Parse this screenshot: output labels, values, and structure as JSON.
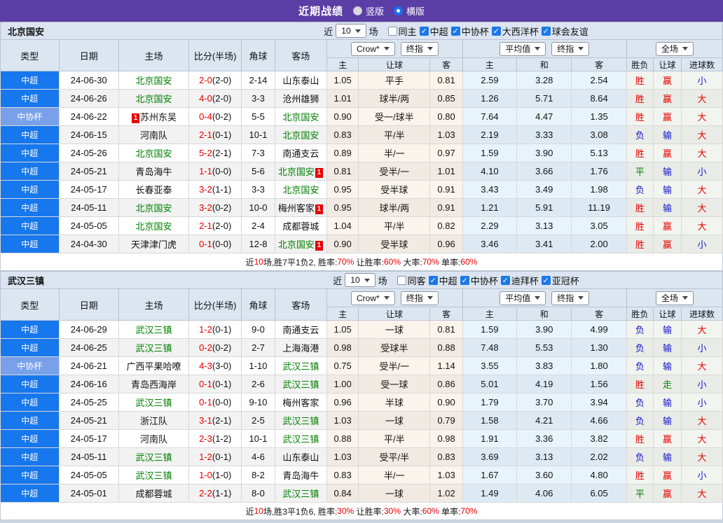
{
  "title_bar": {
    "title": "近期战绩",
    "vertical_label": "竖版",
    "horizontal_label": "横版"
  },
  "table_header": {
    "type": "类型",
    "date": "日期",
    "home": "主场",
    "score": "比分(半场)",
    "corner": "角球",
    "away": "客场",
    "sub": {
      "home_odds": "主",
      "handicap": "让球",
      "away_odds": "客",
      "avg_home": "主",
      "avg_draw": "和",
      "avg_away": "客",
      "result": "胜负",
      "handicap_result": "让球",
      "goals": "进球数"
    },
    "selects": {
      "company": "Crow*",
      "company_stage": "终指",
      "average": "平均值",
      "average_stage": "终指",
      "fulltime": "全场"
    }
  },
  "colors": {
    "accent_purple": "#5b3da6",
    "league_super": "#1777ec",
    "league_cup": "#79a1ea",
    "win_red": "#e60000",
    "lose_blue": "#1414cd",
    "draw_green": "#008000",
    "team_green": "#008000"
  },
  "sections": [
    {
      "team": "北京国安",
      "filters": {
        "near": "近",
        "count": "10",
        "unit": "场",
        "same": {
          "label": "同主",
          "checked": false
        },
        "leagues": [
          {
            "label": "中超",
            "checked": true
          },
          {
            "label": "中协杯",
            "checked": true
          },
          {
            "label": "大西洋杯",
            "checked": true
          },
          {
            "label": "球会友谊",
            "checked": true
          }
        ]
      },
      "rows": [
        {
          "league": "中超",
          "cup": false,
          "date": "24-06-30",
          "home": {
            "name": "北京国安",
            "green": true
          },
          "score": "2-0",
          "half": "(2-0)",
          "corner": "2-14",
          "away": {
            "name": "山东泰山"
          },
          "odds": [
            "1.05",
            "平手",
            "0.81"
          ],
          "avg": [
            "2.59",
            "3.28",
            "2.54"
          ],
          "res": [
            {
              "t": "胜",
              "c": "r"
            },
            {
              "t": "赢",
              "c": "r"
            },
            {
              "t": "小",
              "c": "b"
            }
          ]
        },
        {
          "league": "中超",
          "cup": false,
          "date": "24-06-26",
          "home": {
            "name": "北京国安",
            "green": true
          },
          "score": "4-0",
          "half": "(2-0)",
          "corner": "3-3",
          "away": {
            "name": "沧州雄狮"
          },
          "odds": [
            "1.01",
            "球半/两",
            "0.85"
          ],
          "avg": [
            "1.26",
            "5.71",
            "8.64"
          ],
          "res": [
            {
              "t": "胜",
              "c": "r"
            },
            {
              "t": "赢",
              "c": "r"
            },
            {
              "t": "大",
              "c": "r"
            }
          ]
        },
        {
          "league": "中协杯",
          "cup": true,
          "date": "24-06-22",
          "home": {
            "name": "苏州东吴",
            "card": "before"
          },
          "score": "0-4",
          "half": "(0-2)",
          "corner": "5-5",
          "away": {
            "name": "北京国安",
            "green": true
          },
          "odds": [
            "0.90",
            "受一/球半",
            "0.80"
          ],
          "avg": [
            "7.64",
            "4.47",
            "1.35"
          ],
          "res": [
            {
              "t": "胜",
              "c": "r"
            },
            {
              "t": "赢",
              "c": "r"
            },
            {
              "t": "大",
              "c": "r"
            }
          ]
        },
        {
          "league": "中超",
          "cup": false,
          "date": "24-06-15",
          "home": {
            "name": "河南队"
          },
          "score": "2-1",
          "half": "(0-1)",
          "corner": "10-1",
          "away": {
            "name": "北京国安",
            "green": true
          },
          "odds": [
            "0.83",
            "平/半",
            "1.03"
          ],
          "avg": [
            "2.19",
            "3.33",
            "3.08"
          ],
          "res": [
            {
              "t": "负",
              "c": "b"
            },
            {
              "t": "输",
              "c": "b"
            },
            {
              "t": "大",
              "c": "r"
            }
          ]
        },
        {
          "league": "中超",
          "cup": false,
          "date": "24-05-26",
          "home": {
            "name": "北京国安",
            "green": true
          },
          "score": "5-2",
          "half": "(2-1)",
          "corner": "7-3",
          "away": {
            "name": "南通支云"
          },
          "odds": [
            "0.89",
            "半/一",
            "0.97"
          ],
          "avg": [
            "1.59",
            "3.90",
            "5.13"
          ],
          "res": [
            {
              "t": "胜",
              "c": "r"
            },
            {
              "t": "赢",
              "c": "r"
            },
            {
              "t": "大",
              "c": "r"
            }
          ]
        },
        {
          "league": "中超",
          "cup": false,
          "date": "24-05-21",
          "home": {
            "name": "青岛海牛"
          },
          "score": "1-1",
          "half": "(0-0)",
          "corner": "5-6",
          "away": {
            "name": "北京国安",
            "green": true,
            "card": "after"
          },
          "odds": [
            "0.81",
            "受半/一",
            "1.01"
          ],
          "avg": [
            "4.10",
            "3.66",
            "1.76"
          ],
          "res": [
            {
              "t": "平",
              "c": "g"
            },
            {
              "t": "输",
              "c": "b"
            },
            {
              "t": "小",
              "c": "b"
            }
          ]
        },
        {
          "league": "中超",
          "cup": false,
          "date": "24-05-17",
          "home": {
            "name": "长春亚泰"
          },
          "score": "3-2",
          "half": "(1-1)",
          "corner": "3-3",
          "away": {
            "name": "北京国安",
            "green": true
          },
          "odds": [
            "0.95",
            "受半球",
            "0.91"
          ],
          "avg": [
            "3.43",
            "3.49",
            "1.98"
          ],
          "res": [
            {
              "t": "负",
              "c": "b"
            },
            {
              "t": "输",
              "c": "b"
            },
            {
              "t": "大",
              "c": "r"
            }
          ]
        },
        {
          "league": "中超",
          "cup": false,
          "date": "24-05-11",
          "home": {
            "name": "北京国安",
            "green": true
          },
          "score": "3-2",
          "half": "(0-2)",
          "corner": "10-0",
          "away": {
            "name": "梅州客家",
            "card": "after"
          },
          "odds": [
            "0.95",
            "球半/两",
            "0.91"
          ],
          "avg": [
            "1.21",
            "5.91",
            "11.19"
          ],
          "res": [
            {
              "t": "胜",
              "c": "r"
            },
            {
              "t": "输",
              "c": "b"
            },
            {
              "t": "大",
              "c": "r"
            }
          ]
        },
        {
          "league": "中超",
          "cup": false,
          "date": "24-05-05",
          "home": {
            "name": "北京国安",
            "green": true
          },
          "score": "2-1",
          "half": "(2-0)",
          "corner": "2-4",
          "away": {
            "name": "成都蓉城"
          },
          "odds": [
            "1.04",
            "平/半",
            "0.82"
          ],
          "avg": [
            "2.29",
            "3.13",
            "3.05"
          ],
          "res": [
            {
              "t": "胜",
              "c": "r"
            },
            {
              "t": "赢",
              "c": "r"
            },
            {
              "t": "大",
              "c": "r"
            }
          ]
        },
        {
          "league": "中超",
          "cup": false,
          "date": "24-04-30",
          "home": {
            "name": "天津津门虎"
          },
          "score": "0-1",
          "half": "(0-0)",
          "corner": "12-8",
          "away": {
            "name": "北京国安",
            "green": true,
            "card": "after"
          },
          "odds": [
            "0.90",
            "受半球",
            "0.96"
          ],
          "avg": [
            "3.46",
            "3.41",
            "2.00"
          ],
          "res": [
            {
              "t": "胜",
              "c": "r"
            },
            {
              "t": "赢",
              "c": "r"
            },
            {
              "t": "小",
              "c": "b"
            }
          ]
        }
      ],
      "summary": [
        {
          "text": "近"
        },
        {
          "text": "10",
          "red": true
        },
        {
          "text": "场,胜7平1负2, 胜率:"
        },
        {
          "text": "70%",
          "red": true
        },
        {
          "text": " 让胜率:"
        },
        {
          "text": "60%",
          "red": true
        },
        {
          "text": " 大率:"
        },
        {
          "text": "70%",
          "red": true
        },
        {
          "text": " 单率:"
        },
        {
          "text": "60%",
          "red": true
        }
      ]
    },
    {
      "team": "武汉三镇",
      "filters": {
        "near": "近",
        "count": "10",
        "unit": "场",
        "same": {
          "label": "同客",
          "checked": false
        },
        "leagues": [
          {
            "label": "中超",
            "checked": true
          },
          {
            "label": "中协杯",
            "checked": true
          },
          {
            "label": "迪拜杯",
            "checked": true
          },
          {
            "label": "亚冠杯",
            "checked": true
          }
        ]
      },
      "rows": [
        {
          "league": "中超",
          "cup": false,
          "date": "24-06-29",
          "home": {
            "name": "武汉三镇",
            "green": true
          },
          "score": "1-2",
          "half": "(0-1)",
          "corner": "9-0",
          "away": {
            "name": "南通支云"
          },
          "odds": [
            "1.05",
            "一球",
            "0.81"
          ],
          "avg": [
            "1.59",
            "3.90",
            "4.99"
          ],
          "res": [
            {
              "t": "负",
              "c": "b"
            },
            {
              "t": "输",
              "c": "b"
            },
            {
              "t": "大",
              "c": "r"
            }
          ]
        },
        {
          "league": "中超",
          "cup": false,
          "date": "24-06-25",
          "home": {
            "name": "武汉三镇",
            "green": true
          },
          "score": "0-2",
          "half": "(0-2)",
          "corner": "2-7",
          "away": {
            "name": "上海海港"
          },
          "odds": [
            "0.98",
            "受球半",
            "0.88"
          ],
          "avg": [
            "7.48",
            "5.53",
            "1.30"
          ],
          "res": [
            {
              "t": "负",
              "c": "b"
            },
            {
              "t": "输",
              "c": "b"
            },
            {
              "t": "小",
              "c": "b"
            }
          ]
        },
        {
          "league": "中协杯",
          "cup": true,
          "date": "24-06-21",
          "home": {
            "name": "广西平果哈嘹"
          },
          "score": "4-3",
          "half": "(3-0)",
          "corner": "1-10",
          "away": {
            "name": "武汉三镇",
            "green": true
          },
          "odds": [
            "0.75",
            "受半/一",
            "1.14"
          ],
          "avg": [
            "3.55",
            "3.83",
            "1.80"
          ],
          "res": [
            {
              "t": "负",
              "c": "b"
            },
            {
              "t": "输",
              "c": "b"
            },
            {
              "t": "大",
              "c": "r"
            }
          ]
        },
        {
          "league": "中超",
          "cup": false,
          "date": "24-06-16",
          "home": {
            "name": "青岛西海岸"
          },
          "score": "0-1",
          "half": "(0-1)",
          "corner": "2-6",
          "away": {
            "name": "武汉三镇",
            "green": true
          },
          "odds": [
            "1.00",
            "受一球",
            "0.86"
          ],
          "avg": [
            "5.01",
            "4.19",
            "1.56"
          ],
          "res": [
            {
              "t": "胜",
              "c": "r"
            },
            {
              "t": "走",
              "c": "g"
            },
            {
              "t": "小",
              "c": "b"
            }
          ]
        },
        {
          "league": "中超",
          "cup": false,
          "date": "24-05-25",
          "home": {
            "name": "武汉三镇",
            "green": true
          },
          "score": "0-1",
          "half": "(0-0)",
          "corner": "9-10",
          "away": {
            "name": "梅州客家"
          },
          "odds": [
            "0.96",
            "半球",
            "0.90"
          ],
          "avg": [
            "1.79",
            "3.70",
            "3.94"
          ],
          "res": [
            {
              "t": "负",
              "c": "b"
            },
            {
              "t": "输",
              "c": "b"
            },
            {
              "t": "小",
              "c": "b"
            }
          ]
        },
        {
          "league": "中超",
          "cup": false,
          "date": "24-05-21",
          "home": {
            "name": "浙江队"
          },
          "score": "3-1",
          "half": "(2-1)",
          "corner": "2-5",
          "away": {
            "name": "武汉三镇",
            "green": true
          },
          "odds": [
            "1.03",
            "一球",
            "0.79"
          ],
          "avg": [
            "1.58",
            "4.21",
            "4.66"
          ],
          "res": [
            {
              "t": "负",
              "c": "b"
            },
            {
              "t": "输",
              "c": "b"
            },
            {
              "t": "大",
              "c": "r"
            }
          ]
        },
        {
          "league": "中超",
          "cup": false,
          "date": "24-05-17",
          "home": {
            "name": "河南队"
          },
          "score": "2-3",
          "half": "(1-2)",
          "corner": "10-1",
          "away": {
            "name": "武汉三镇",
            "green": true
          },
          "odds": [
            "0.88",
            "平/半",
            "0.98"
          ],
          "avg": [
            "1.91",
            "3.36",
            "3.82"
          ],
          "res": [
            {
              "t": "胜",
              "c": "r"
            },
            {
              "t": "赢",
              "c": "r"
            },
            {
              "t": "大",
              "c": "r"
            }
          ]
        },
        {
          "league": "中超",
          "cup": false,
          "date": "24-05-11",
          "home": {
            "name": "武汉三镇",
            "green": true
          },
          "score": "1-2",
          "half": "(0-1)",
          "corner": "4-6",
          "away": {
            "name": "山东泰山"
          },
          "odds": [
            "1.03",
            "受平/半",
            "0.83"
          ],
          "avg": [
            "3.69",
            "3.13",
            "2.02"
          ],
          "res": [
            {
              "t": "负",
              "c": "b"
            },
            {
              "t": "输",
              "c": "b"
            },
            {
              "t": "大",
              "c": "r"
            }
          ]
        },
        {
          "league": "中超",
          "cup": false,
          "date": "24-05-05",
          "home": {
            "name": "武汉三镇",
            "green": true
          },
          "score": "1-0",
          "half": "(1-0)",
          "corner": "8-2",
          "away": {
            "name": "青岛海牛"
          },
          "odds": [
            "0.83",
            "半/一",
            "1.03"
          ],
          "avg": [
            "1.67",
            "3.60",
            "4.80"
          ],
          "res": [
            {
              "t": "胜",
              "c": "r"
            },
            {
              "t": "赢",
              "c": "r"
            },
            {
              "t": "小",
              "c": "b"
            }
          ]
        },
        {
          "league": "中超",
          "cup": false,
          "date": "24-05-01",
          "home": {
            "name": "成都蓉城"
          },
          "score": "2-2",
          "half": "(1-1)",
          "corner": "8-0",
          "away": {
            "name": "武汉三镇",
            "green": true
          },
          "odds": [
            "0.84",
            "一球",
            "1.02"
          ],
          "avg": [
            "1.49",
            "4.06",
            "6.05"
          ],
          "res": [
            {
              "t": "平",
              "c": "g"
            },
            {
              "t": "赢",
              "c": "r"
            },
            {
              "t": "大",
              "c": "r"
            }
          ]
        }
      ],
      "summary": [
        {
          "text": "近"
        },
        {
          "text": "10",
          "red": true
        },
        {
          "text": "场,胜3平1负6, 胜率:"
        },
        {
          "text": "30%",
          "red": true
        },
        {
          "text": " 让胜率:"
        },
        {
          "text": "30%",
          "red": true
        },
        {
          "text": " 大率:"
        },
        {
          "text": "60%",
          "red": true
        },
        {
          "text": " 单率:"
        },
        {
          "text": "70%",
          "red": true
        }
      ]
    }
  ]
}
